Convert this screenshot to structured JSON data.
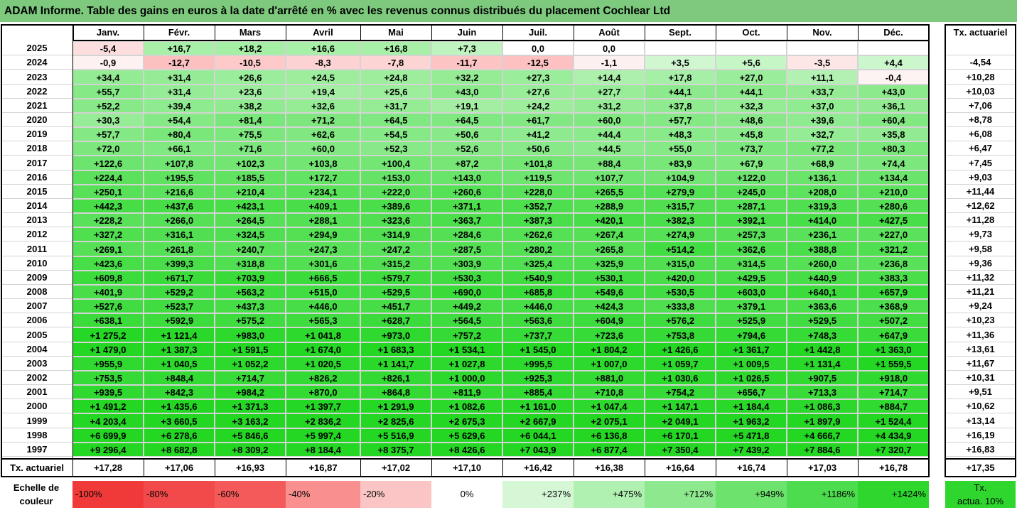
{
  "title": "ADAM Informe. Table des gains en euros à la date d'arrêté en % avec les revenus connus distribués du placement Cochlear Ltd",
  "months": [
    "Janv.",
    "Févr.",
    "Mars",
    "Avril",
    "Mai",
    "Juin",
    "Juil.",
    "Août",
    "Sept.",
    "Oct.",
    "Nov.",
    "Déc."
  ],
  "rate_header": "Tx. actuariel",
  "rows": [
    {
      "year": "2025",
      "values": [
        "-5,4",
        "+16,7",
        "+18,2",
        "+16,6",
        "+16,8",
        "+7,3",
        "0,0",
        "0,0",
        "",
        "",
        "",
        ""
      ],
      "rate": ""
    },
    {
      "year": "2024",
      "values": [
        "-0,9",
        "-12,7",
        "-10,5",
        "-8,3",
        "-7,8",
        "-11,7",
        "-12,5",
        "-1,1",
        "+3,5",
        "+5,6",
        "-3,5",
        "+4,4"
      ],
      "rate": "-4,54"
    },
    {
      "year": "2023",
      "values": [
        "+34,4",
        "+31,4",
        "+26,6",
        "+24,5",
        "+24,8",
        "+32,2",
        "+27,3",
        "+14,4",
        "+17,8",
        "+27,0",
        "+11,1",
        "-0,4"
      ],
      "rate": "+10,28"
    },
    {
      "year": "2022",
      "values": [
        "+55,7",
        "+31,4",
        "+23,6",
        "+19,4",
        "+25,6",
        "+43,0",
        "+27,6",
        "+27,7",
        "+44,1",
        "+44,1",
        "+33,7",
        "+43,0"
      ],
      "rate": "+10,03"
    },
    {
      "year": "2021",
      "values": [
        "+52,2",
        "+39,4",
        "+38,2",
        "+32,6",
        "+31,7",
        "+19,1",
        "+24,2",
        "+31,2",
        "+37,8",
        "+32,3",
        "+37,0",
        "+36,1"
      ],
      "rate": "+7,06"
    },
    {
      "year": "2020",
      "values": [
        "+30,3",
        "+54,4",
        "+81,4",
        "+71,2",
        "+64,5",
        "+64,5",
        "+61,7",
        "+60,0",
        "+57,7",
        "+48,6",
        "+39,6",
        "+60,4"
      ],
      "rate": "+8,78"
    },
    {
      "year": "2019",
      "values": [
        "+57,7",
        "+80,4",
        "+75,5",
        "+62,6",
        "+54,5",
        "+50,6",
        "+41,2",
        "+44,4",
        "+48,3",
        "+45,8",
        "+32,7",
        "+35,8"
      ],
      "rate": "+6,08"
    },
    {
      "year": "2018",
      "values": [
        "+72,0",
        "+66,1",
        "+71,6",
        "+60,0",
        "+52,3",
        "+52,6",
        "+50,6",
        "+44,5",
        "+55,0",
        "+73,7",
        "+77,2",
        "+80,3"
      ],
      "rate": "+6,47"
    },
    {
      "year": "2017",
      "values": [
        "+122,6",
        "+107,8",
        "+102,3",
        "+103,8",
        "+100,4",
        "+87,2",
        "+101,8",
        "+88,4",
        "+83,9",
        "+67,9",
        "+68,9",
        "+74,4"
      ],
      "rate": "+7,45"
    },
    {
      "year": "2016",
      "values": [
        "+224,4",
        "+195,5",
        "+185,5",
        "+172,7",
        "+153,0",
        "+143,0",
        "+119,5",
        "+107,7",
        "+104,9",
        "+122,0",
        "+136,1",
        "+134,4"
      ],
      "rate": "+9,03"
    },
    {
      "year": "2015",
      "values": [
        "+250,1",
        "+216,6",
        "+210,4",
        "+234,1",
        "+222,0",
        "+260,6",
        "+228,0",
        "+265,5",
        "+279,9",
        "+245,0",
        "+208,0",
        "+210,0"
      ],
      "rate": "+11,44"
    },
    {
      "year": "2014",
      "values": [
        "+442,3",
        "+437,6",
        "+423,1",
        "+409,1",
        "+389,6",
        "+371,1",
        "+352,7",
        "+288,9",
        "+315,7",
        "+287,1",
        "+319,3",
        "+280,6"
      ],
      "rate": "+12,62"
    },
    {
      "year": "2013",
      "values": [
        "+228,2",
        "+266,0",
        "+264,5",
        "+288,1",
        "+323,6",
        "+363,7",
        "+387,3",
        "+420,1",
        "+382,3",
        "+392,1",
        "+414,0",
        "+427,5"
      ],
      "rate": "+11,28"
    },
    {
      "year": "2012",
      "values": [
        "+327,2",
        "+316,1",
        "+324,5",
        "+294,9",
        "+314,9",
        "+284,6",
        "+262,6",
        "+267,4",
        "+274,9",
        "+257,3",
        "+236,1",
        "+227,0"
      ],
      "rate": "+9,73"
    },
    {
      "year": "2011",
      "values": [
        "+269,1",
        "+261,8",
        "+240,7",
        "+247,3",
        "+247,2",
        "+287,5",
        "+280,2",
        "+265,8",
        "+514,2",
        "+362,6",
        "+388,8",
        "+321,2"
      ],
      "rate": "+9,58"
    },
    {
      "year": "2010",
      "values": [
        "+423,6",
        "+399,3",
        "+318,8",
        "+301,6",
        "+315,2",
        "+303,9",
        "+325,4",
        "+325,9",
        "+315,0",
        "+314,5",
        "+260,0",
        "+236,8"
      ],
      "rate": "+9,36"
    },
    {
      "year": "2009",
      "values": [
        "+609,8",
        "+671,7",
        "+703,9",
        "+666,5",
        "+579,7",
        "+530,3",
        "+540,9",
        "+530,1",
        "+420,0",
        "+429,5",
        "+440,9",
        "+383,3"
      ],
      "rate": "+11,32"
    },
    {
      "year": "2008",
      "values": [
        "+401,9",
        "+529,2",
        "+563,2",
        "+515,0",
        "+529,5",
        "+690,0",
        "+685,8",
        "+549,6",
        "+530,5",
        "+603,0",
        "+640,1",
        "+657,9"
      ],
      "rate": "+11,21"
    },
    {
      "year": "2007",
      "values": [
        "+527,6",
        "+523,7",
        "+437,3",
        "+446,0",
        "+451,7",
        "+449,2",
        "+446,0",
        "+424,3",
        "+333,8",
        "+379,1",
        "+363,6",
        "+368,9"
      ],
      "rate": "+9,24"
    },
    {
      "year": "2006",
      "values": [
        "+638,1",
        "+592,9",
        "+575,2",
        "+565,3",
        "+628,7",
        "+564,5",
        "+563,6",
        "+604,9",
        "+576,2",
        "+525,9",
        "+529,5",
        "+507,2"
      ],
      "rate": "+10,23"
    },
    {
      "year": "2005",
      "values": [
        "+1 275,2",
        "+1 121,4",
        "+983,0",
        "+1 041,8",
        "+973,0",
        "+757,2",
        "+737,7",
        "+723,6",
        "+753,8",
        "+794,6",
        "+748,3",
        "+647,9"
      ],
      "rate": "+11,36"
    },
    {
      "year": "2004",
      "values": [
        "+1 479,0",
        "+1 387,3",
        "+1 591,5",
        "+1 674,0",
        "+1 683,3",
        "+1 534,1",
        "+1 545,0",
        "+1 804,2",
        "+1 426,6",
        "+1 361,7",
        "+1 442,8",
        "+1 363,0"
      ],
      "rate": "+13,61"
    },
    {
      "year": "2003",
      "values": [
        "+955,9",
        "+1 040,5",
        "+1 052,2",
        "+1 020,5",
        "+1 141,7",
        "+1 027,8",
        "+995,5",
        "+1 007,0",
        "+1 059,7",
        "+1 009,5",
        "+1 131,4",
        "+1 559,5"
      ],
      "rate": "+11,67"
    },
    {
      "year": "2002",
      "values": [
        "+753,5",
        "+848,4",
        "+714,7",
        "+826,2",
        "+826,1",
        "+1 000,0",
        "+925,3",
        "+881,0",
        "+1 030,6",
        "+1 026,5",
        "+907,5",
        "+918,0"
      ],
      "rate": "+10,31"
    },
    {
      "year": "2001",
      "values": [
        "+939,5",
        "+842,3",
        "+984,2",
        "+870,0",
        "+864,8",
        "+811,9",
        "+885,4",
        "+710,8",
        "+754,2",
        "+656,7",
        "+713,3",
        "+714,7"
      ],
      "rate": "+9,51"
    },
    {
      "year": "2000",
      "values": [
        "+1 491,2",
        "+1 435,6",
        "+1 371,3",
        "+1 397,7",
        "+1 291,9",
        "+1 082,6",
        "+1 161,0",
        "+1 047,4",
        "+1 147,1",
        "+1 184,4",
        "+1 086,3",
        "+884,7"
      ],
      "rate": "+10,62"
    },
    {
      "year": "1999",
      "values": [
        "+4 203,4",
        "+3 660,5",
        "+3 163,2",
        "+2 836,2",
        "+2 825,6",
        "+2 675,3",
        "+2 667,9",
        "+2 075,1",
        "+2 049,1",
        "+1 963,2",
        "+1 897,9",
        "+1 524,4"
      ],
      "rate": "+13,14"
    },
    {
      "year": "1998",
      "values": [
        "+6 699,9",
        "+6 278,6",
        "+5 846,6",
        "+5 997,4",
        "+5 516,9",
        "+5 629,6",
        "+6 044,1",
        "+6 136,8",
        "+6 170,1",
        "+5 471,8",
        "+4 666,7",
        "+4 434,9"
      ],
      "rate": "+16,19"
    },
    {
      "year": "1997",
      "values": [
        "+9 296,4",
        "+8 682,8",
        "+8 309,2",
        "+8 184,4",
        "+8 375,7",
        "+8 426,6",
        "+7 043,9",
        "+6 877,4",
        "+7 350,4",
        "+7 439,2",
        "+7 884,6",
        "+7 320,7"
      ],
      "rate": "+16,83"
    }
  ],
  "footer": {
    "label": "Tx. actuariel",
    "values": [
      "+17,28",
      "+17,06",
      "+16,93",
      "+16,87",
      "+17,02",
      "+17,10",
      "+16,42",
      "+16,38",
      "+16,64",
      "+16,74",
      "+17,03",
      "+16,78"
    ],
    "rate": "+17,35"
  },
  "legend": {
    "label_line1": "Echelle de",
    "label_line2": "couleur",
    "items": [
      {
        "text": "-100%",
        "color": "#f03a3a",
        "align": "left"
      },
      {
        "text": "-80%",
        "color": "#f24a4a",
        "align": "left"
      },
      {
        "text": "-60%",
        "color": "#f55a5a",
        "align": "left"
      },
      {
        "text": "-40%",
        "color": "#f98f8f",
        "align": "left"
      },
      {
        "text": "-20%",
        "color": "#fbc5c5",
        "align": "left"
      },
      {
        "text": "0%",
        "color": "#ffffff",
        "align": "center"
      },
      {
        "text": "+237%",
        "color": "#d6f7d6",
        "align": "right"
      },
      {
        "text": "+475%",
        "color": "#b0f0b0",
        "align": "right"
      },
      {
        "text": "+712%",
        "color": "#8ee88e",
        "align": "right"
      },
      {
        "text": "+949%",
        "color": "#6de26d",
        "align": "right"
      },
      {
        "text": "+1186%",
        "color": "#4ddc4d",
        "align": "right"
      },
      {
        "text": "+1424%",
        "color": "#2ed62e",
        "align": "right"
      }
    ],
    "rate_line1": "Tx.",
    "rate_line2": "actua. 10%",
    "rate_color": "#2ed62e"
  }
}
